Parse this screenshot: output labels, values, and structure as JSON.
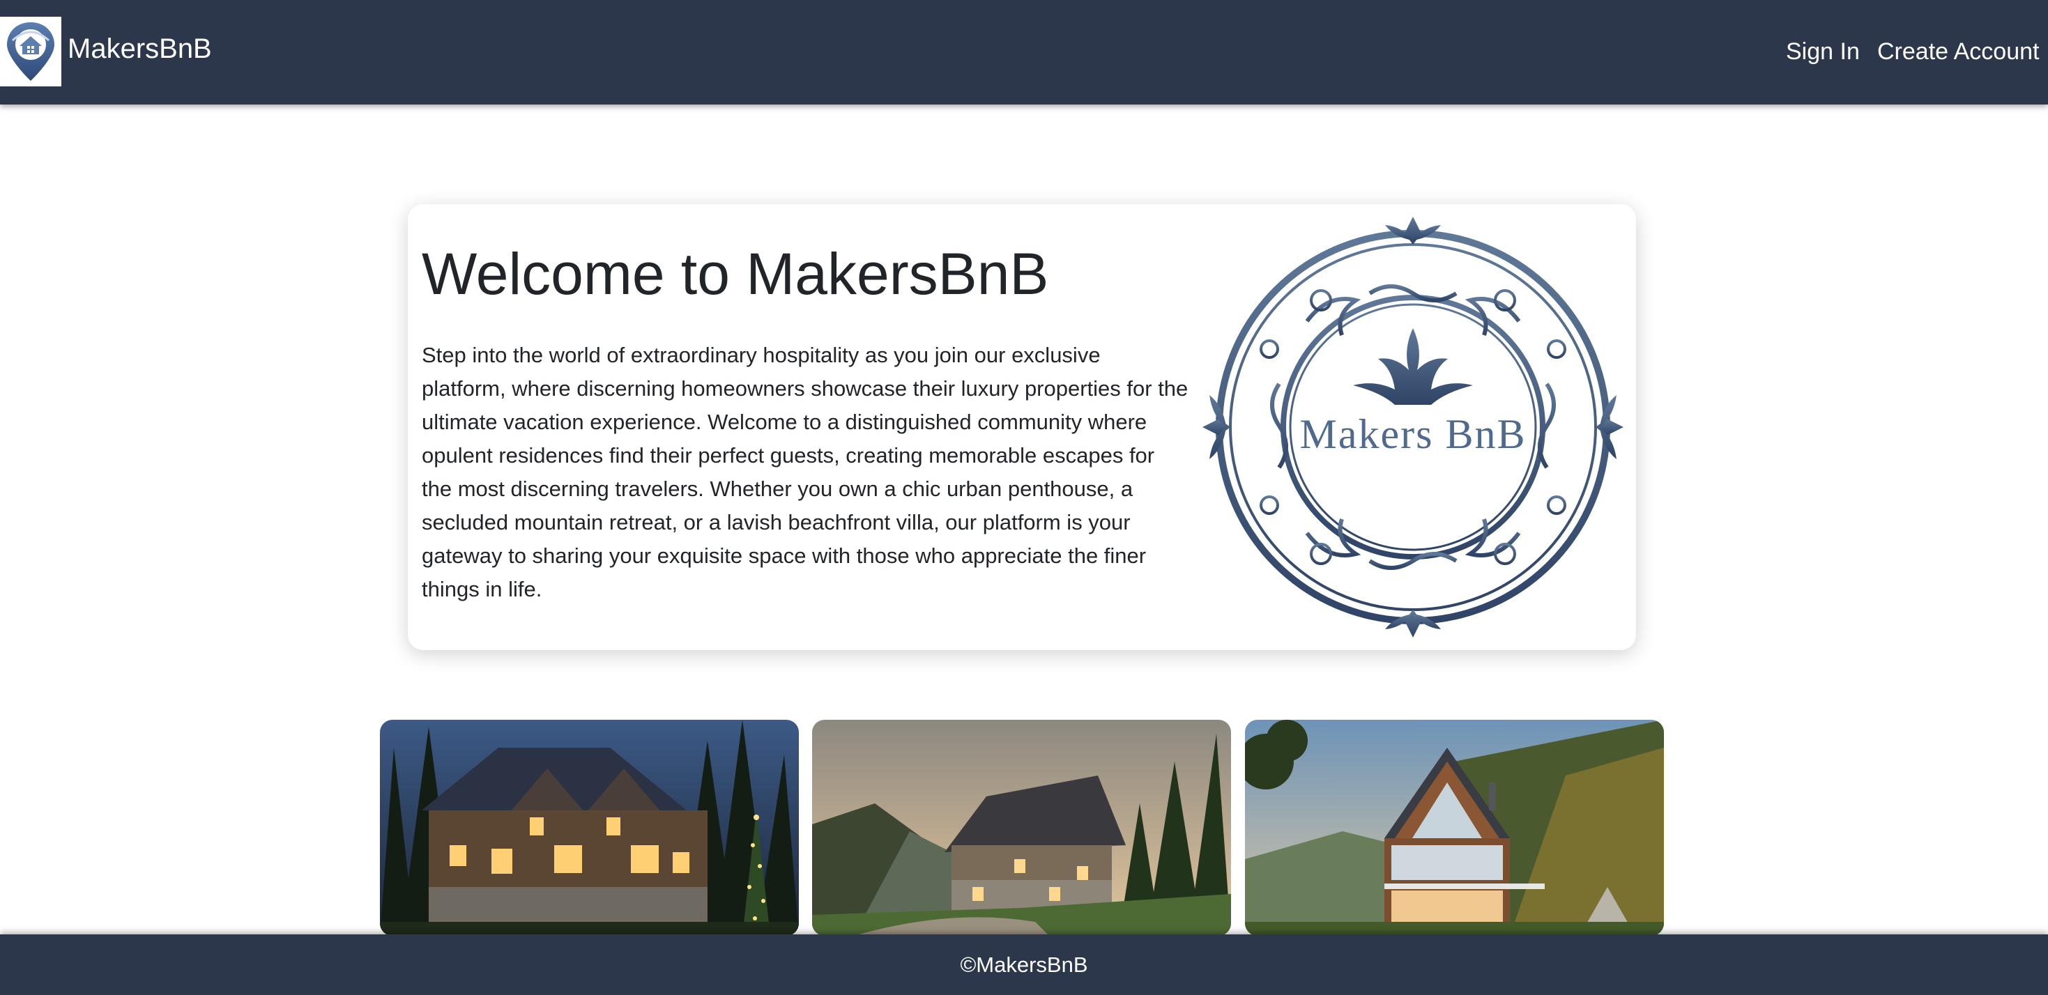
{
  "app": {
    "title": "MakersBnB"
  },
  "navbar": {
    "brand_name": "MakersBnB",
    "links": {
      "sign_in": "Sign In",
      "create_account": "Create Account"
    }
  },
  "hero": {
    "title": "Welcome to MakersBnB",
    "text": "Step into the world of extraordinary hospitality as you join our exclusive platform, where discerning homeowners showcase their luxury properties for the ultimate vacation experience. Welcome to a distinguished community where opulent residences find their perfect guests, creating memorable escapes for the most discerning travelers. Whether you own a chic urban penthouse, a secluded mountain retreat, or a lavish beachfront villa, our platform is your gateway to sharing your exquisite space with those who appreciate the finer things in life.",
    "emblem_text": "Makers BnB"
  },
  "property_cards": [
    {
      "image": "luxury-chalet-night-image"
    },
    {
      "image": "stone-cottage-sunset-image"
    },
    {
      "image": "modern-alpine-house-image"
    }
  ],
  "footer": {
    "text": "©MakersBnB"
  },
  "colors": {
    "nav_bg": "#2c374c",
    "emblem": "#4f6a8c",
    "page_bg": "#ffffff"
  }
}
